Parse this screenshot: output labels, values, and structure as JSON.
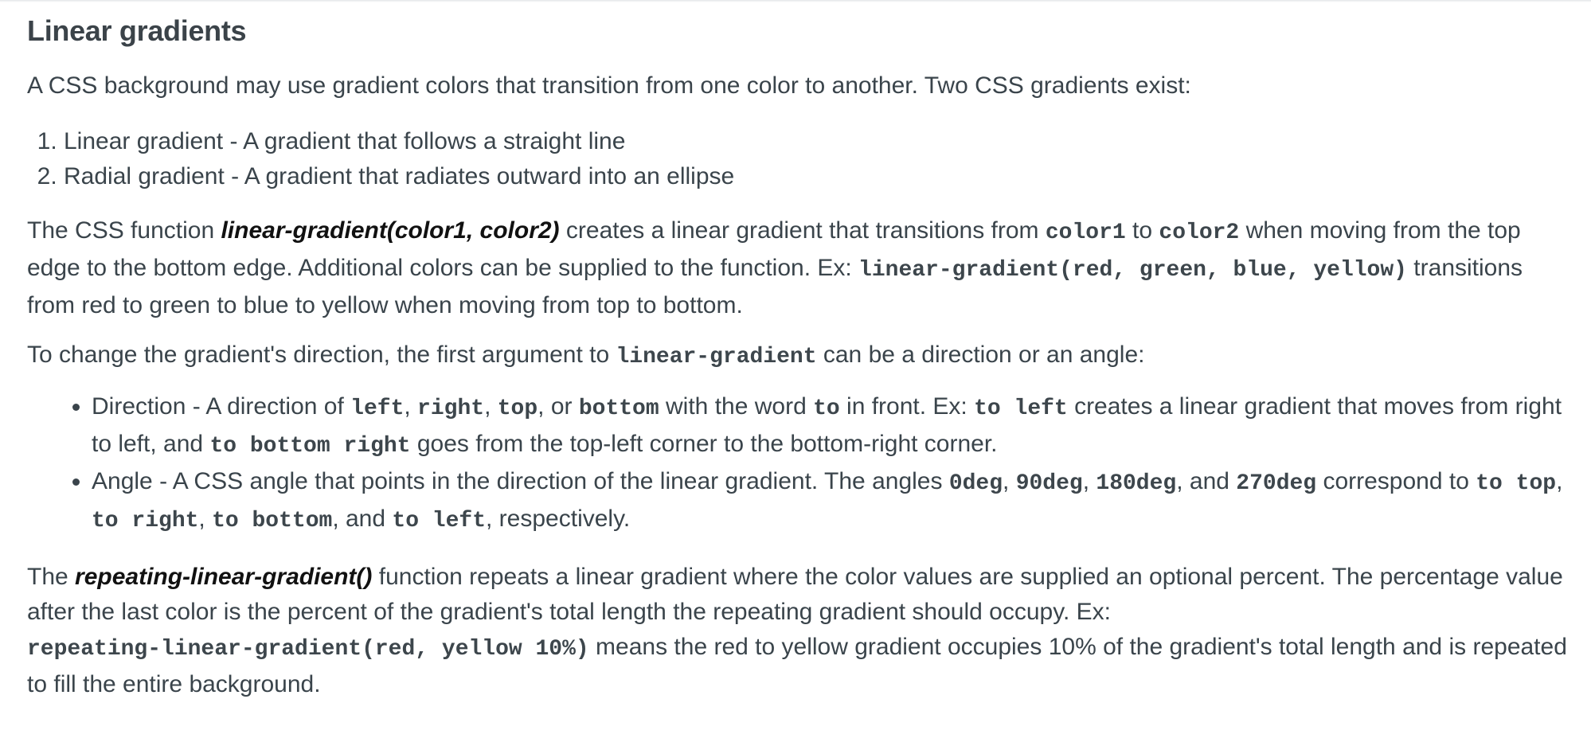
{
  "heading": "Linear gradients",
  "intro": "A CSS background may use gradient colors that transition from one color to another. Two CSS gradients exist:",
  "gradient_types": [
    "Linear gradient - A gradient that follows a straight line",
    "Radial gradient - A gradient that radiates outward into an ellipse"
  ],
  "p_function": {
    "t1": "The CSS function ",
    "fn": "linear-gradient(color1, color2)",
    "t2": " creates a linear gradient that transitions from ",
    "c1": "color1",
    "t3": " to ",
    "c2": "color2",
    "t4": " when moving from the top edge to the bottom edge. Additional colors can be supplied to the function. Ex: ",
    "ex": "linear-gradient(red, green, blue, yellow)",
    "t5": " transitions from red to green to blue to yellow when moving from top to bottom."
  },
  "p_direction": {
    "t1": "To change the gradient's direction, the first argument to ",
    "code": "linear-gradient",
    "t2": " can be a direction or an angle:"
  },
  "bullet_direction": {
    "t1": "Direction - A direction of ",
    "c_left": "left",
    "s1": ", ",
    "c_right": "right",
    "s2": ", ",
    "c_top": "top",
    "s3": ", or ",
    "c_bottom": "bottom",
    "t2": " with the word ",
    "c_to": "to",
    "t3": " in front. Ex: ",
    "c_to_left": "to left",
    "t4": " creates a linear gradient that moves from right to left, and ",
    "c_to_bottom_right": "to bottom right",
    "t5": " goes from the top-left corner to the bottom-right corner."
  },
  "bullet_angle": {
    "t1": "Angle - A CSS angle that points in the direction of the linear gradient. The angles ",
    "c_0": "0deg",
    "s1": ", ",
    "c_90": "90deg",
    "s2": ", ",
    "c_180": "180deg",
    "s3": ", and ",
    "c_270": "270deg",
    "t2": " correspond to ",
    "c_to_top": "to top",
    "s4": ", ",
    "c_to_right": "to right",
    "s5": ", ",
    "c_to_bottom": "to bottom",
    "s6": ", and ",
    "c_to_left": "to left",
    "t3": ", respectively."
  },
  "p_repeating": {
    "t1": "The ",
    "fn": "repeating-linear-gradient()",
    "t2": " function repeats a linear gradient where the color values are supplied an optional percent. The percentage value after the last color is the percent of the gradient's total length the repeating gradient should occupy. Ex: ",
    "ex": "repeating-linear-gradient(red, yellow 10%)",
    "t3": " means the red to yellow gradient occupies 10% of the gradient's total length and is repeated to fill the entire background."
  }
}
